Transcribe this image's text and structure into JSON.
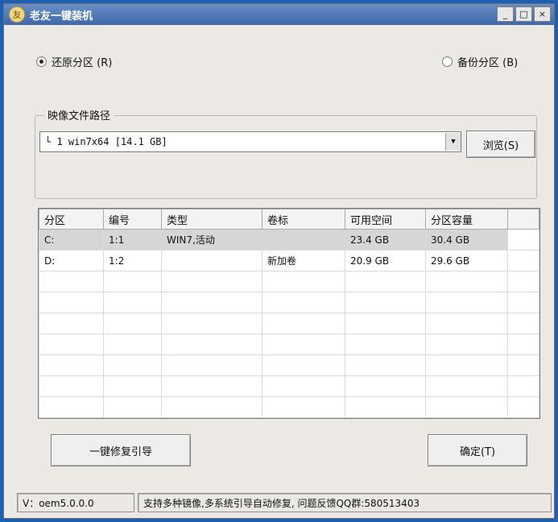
{
  "window": {
    "title": "老友一键装机",
    "icon_glyph": "友"
  },
  "titlebar_buttons": {
    "minimize": "_",
    "maximize": "□",
    "close": "×"
  },
  "mode": {
    "restore_label": "还原分区 (R)",
    "backup_label": "备份分区 (B)",
    "selected": "restore"
  },
  "image_path": {
    "group_label": "映像文件路径",
    "value": "└ 1 win7x64 [14.1 GB]",
    "browse_label": "浏览(S)"
  },
  "partitions": {
    "columns": [
      "分区",
      "编号",
      "类型",
      "卷标",
      "可用空间",
      "分区容量"
    ],
    "rows": [
      [
        "C:",
        "1:1",
        "WIN7,活动",
        "",
        "23.4 GB",
        "30.4 GB"
      ],
      [
        "D:",
        "1:2",
        "",
        "新加卷",
        "20.9 GB",
        "29.6 GB"
      ]
    ],
    "selected_row": 0
  },
  "buttons": {
    "repair_boot": "一键修复引导",
    "ok": "确定(T)"
  },
  "status": {
    "version": "V：oem5.0.0.0",
    "message": "支持多种镜像,多系统引导自动修复, 问题反馈QQ群:580513403"
  },
  "colors": {
    "desktop": "#1d5fb0",
    "titlebar": "#3e68a9",
    "window_bg": "#ece9e4"
  }
}
